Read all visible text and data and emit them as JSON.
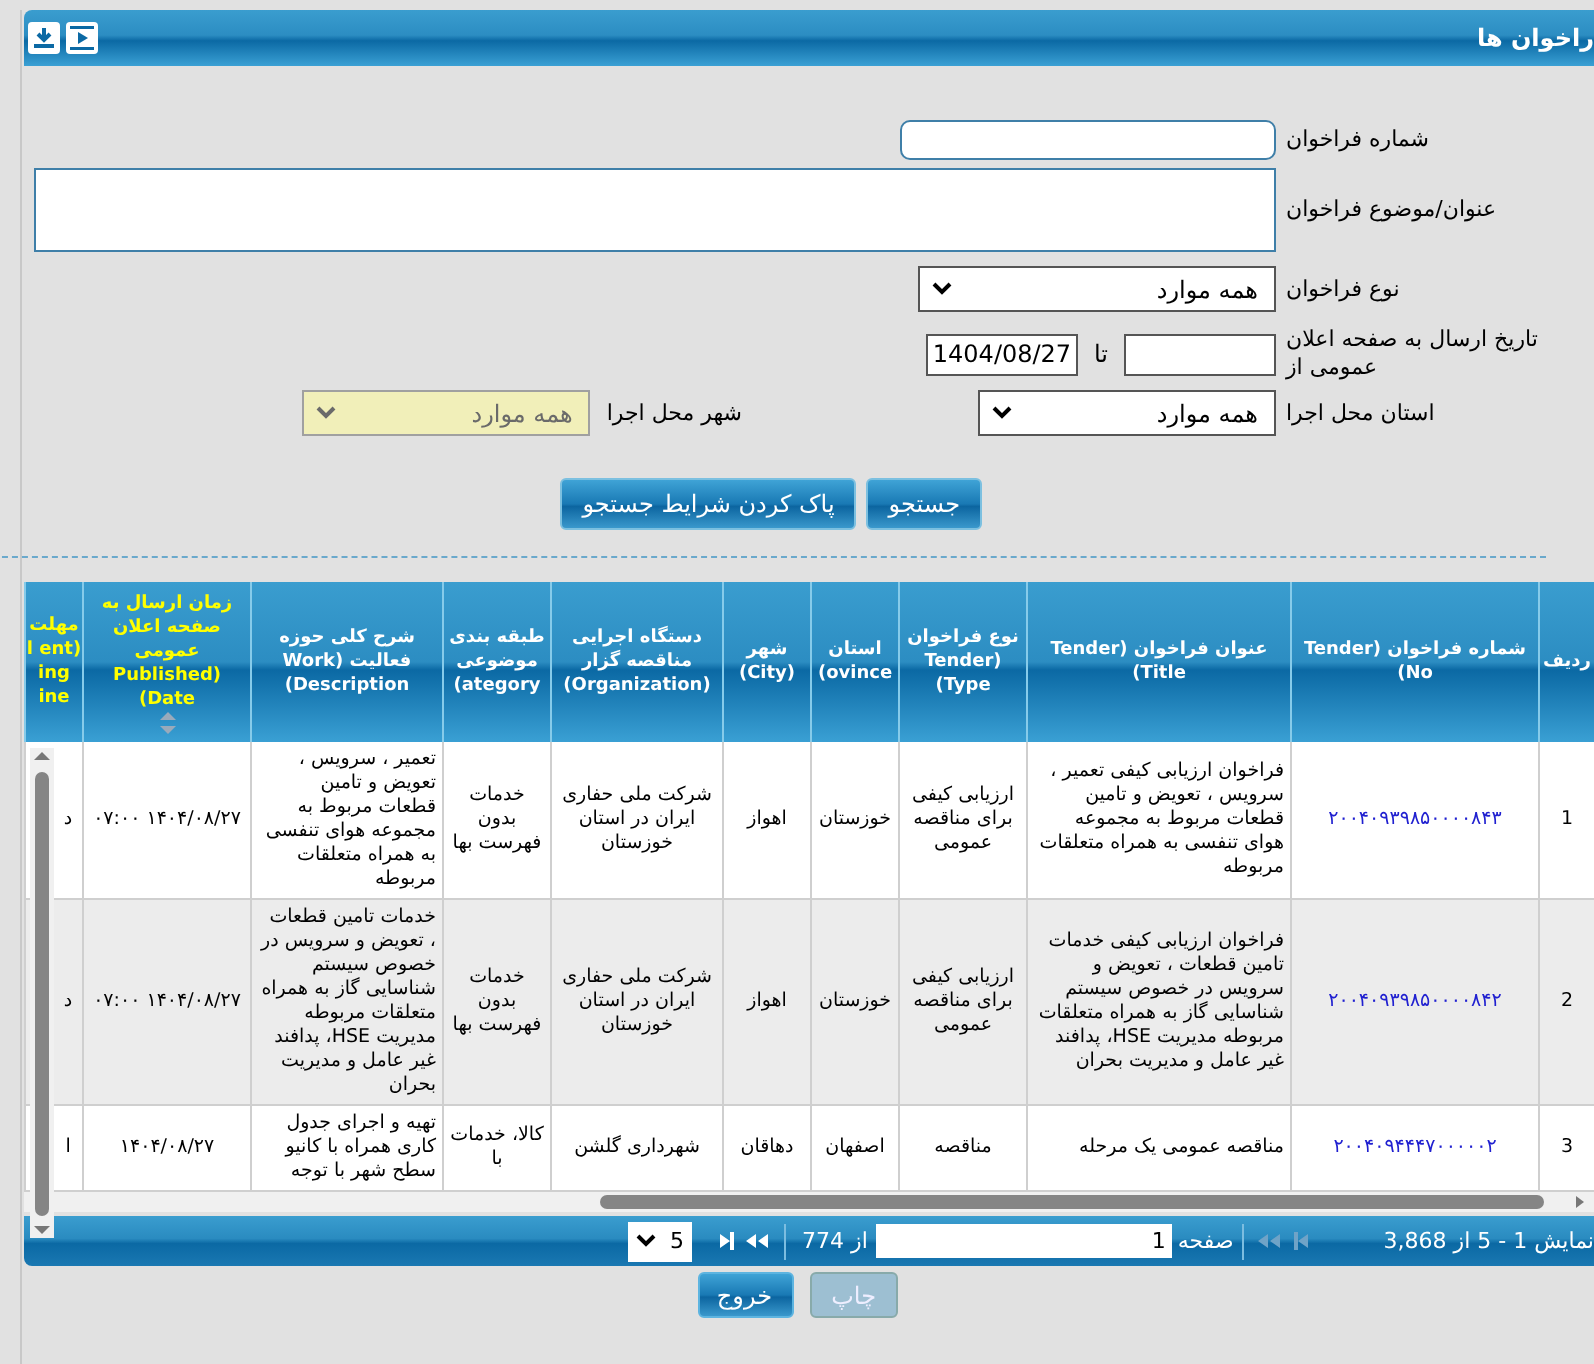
{
  "window": {
    "title": "راخوان ها"
  },
  "form": {
    "fields": [
      {
        "kind": "text",
        "label": "شماره فراخوان"
      },
      {
        "kind": "textarea",
        "label": "عنوان/موضوع فراخوان"
      },
      {
        "kind": "select",
        "label": "نوع فراخوان",
        "value": "همه موارد",
        "disabled": false
      },
      {
        "kind": "daterange",
        "label": "تاریخ ارسال به صفحه اعلان عمومی از",
        "separator": "تا",
        "to_value": "1404/08/27"
      },
      {
        "kind": "selectpair",
        "label": "استان محل اجرا",
        "value": "همه موارد",
        "disabled": false,
        "label2": "شهر محل اجرا",
        "value2": "همه موارد",
        "disabled2": true
      }
    ],
    "buttons": [
      "جستجو",
      "پاک کردن شرایط جستجو"
    ]
  },
  "table": {
    "columns": [
      {
        "label": "ردیف",
        "highlight": false,
        "sortable": false
      },
      {
        "label": "شماره فراخوان (Tender No)",
        "highlight": false,
        "sortable": false
      },
      {
        "label": "عنوان فراخوان (Tender Title)",
        "highlight": false,
        "sortable": false
      },
      {
        "label": "نوع فراخوان (Tender Type)",
        "highlight": false,
        "sortable": false
      },
      {
        "label": "استان ovince)",
        "highlight": false,
        "sortable": false
      },
      {
        "label": "شهر (City)",
        "highlight": false,
        "sortable": false
      },
      {
        "label": "دستگاه اجرایی مناقصه گزار (Organization)",
        "highlight": false,
        "sortable": false
      },
      {
        "label": "طبقه بندی موضوعی ategory)",
        "highlight": false,
        "sortable": false
      },
      {
        "label": "شرح کلی حوزه فعالیت (Work Description)",
        "highlight": false,
        "sortable": false
      },
      {
        "label": "زمان ارسال به صفحه اعلان عمومی (Published Date)",
        "highlight": true,
        "sortable": true
      },
      {
        "label": "مهلت l ent) ing ine",
        "highlight": true,
        "sortable": false
      }
    ],
    "rows": [
      {
        "selected": false,
        "cells": [
          "1",
          "۲۰۰۴۰۹۳۹۸۵۰۰۰۰۸۴۳",
          "فراخوان ارزیابی کیفی تعمیر ، سرویس ، تعویض و تامین قطعات مربوط به مجموعه هوای تنفسی به همراه متعلقات مربوطه",
          "ارزیابی کیفی برای مناقصه عمومی",
          "خوزستان",
          "اهواز",
          "شرکت ملی حفاری ایران در استان خوزستان",
          "خدمات بدون فهرست بها",
          "تعمیر ، سرویس ، تعویض و تامین قطعات مربوط به مجموعه هوای تنفسی به همراه متعلقات مربوطه",
          "۱۴۰۴/۰۸/۲۷ ۰۷:۰۰",
          "د"
        ]
      },
      {
        "selected": true,
        "cells": [
          "2",
          "۲۰۰۴۰۹۳۹۸۵۰۰۰۰۸۴۲",
          "فراخوان ارزیابی کیفی خدمات تامین قطعات ، تعویض و سرویس در خصوص سیستم شناسایی گاز به همراه متعلقات مربوطه مدیریت HSE، پدافند غیر عامل و مدیریت بحران",
          "ارزیابی کیفی برای مناقصه عمومی",
          "خوزستان",
          "اهواز",
          "شرکت ملی حفاری ایران در استان خوزستان",
          "خدمات بدون فهرست بها",
          "خدمات تامین قطعات ، تعویض و سرویس در خصوص سیستم شناسایی گاز به همراه متعلقات مربوطه مدیریت HSE، پدافند غیر عامل و مدیریت بحران",
          "۱۴۰۴/۰۸/۲۷ ۰۷:۰۰",
          "د"
        ]
      },
      {
        "selected": false,
        "cells": [
          "3",
          "۲۰۰۴۰۹۴۴۴۷۰۰۰۰۰۲",
          "مناقصه عمومی یک مرحله",
          "مناقصه",
          "اصفهان",
          "دهاقان",
          "شهرداری گلشن",
          "کالا، خدمات با",
          "تهیه و اجرای جدول کاری همراه با کانیو سطح شهر با توجه",
          "۱۴۰۴/۰۸/۲۷",
          "ا"
        ]
      }
    ]
  },
  "pager": {
    "summary": "نمایش 1 - 5 از 3,868",
    "page_label": "صفحه",
    "page": "1",
    "of_label": "از 774",
    "page_size": "5",
    "prev_disabled": true,
    "next_disabled": false
  },
  "actions": [
    {
      "label": "چاپ",
      "disabled": true
    },
    {
      "label": "خروج",
      "disabled": false
    }
  ]
}
